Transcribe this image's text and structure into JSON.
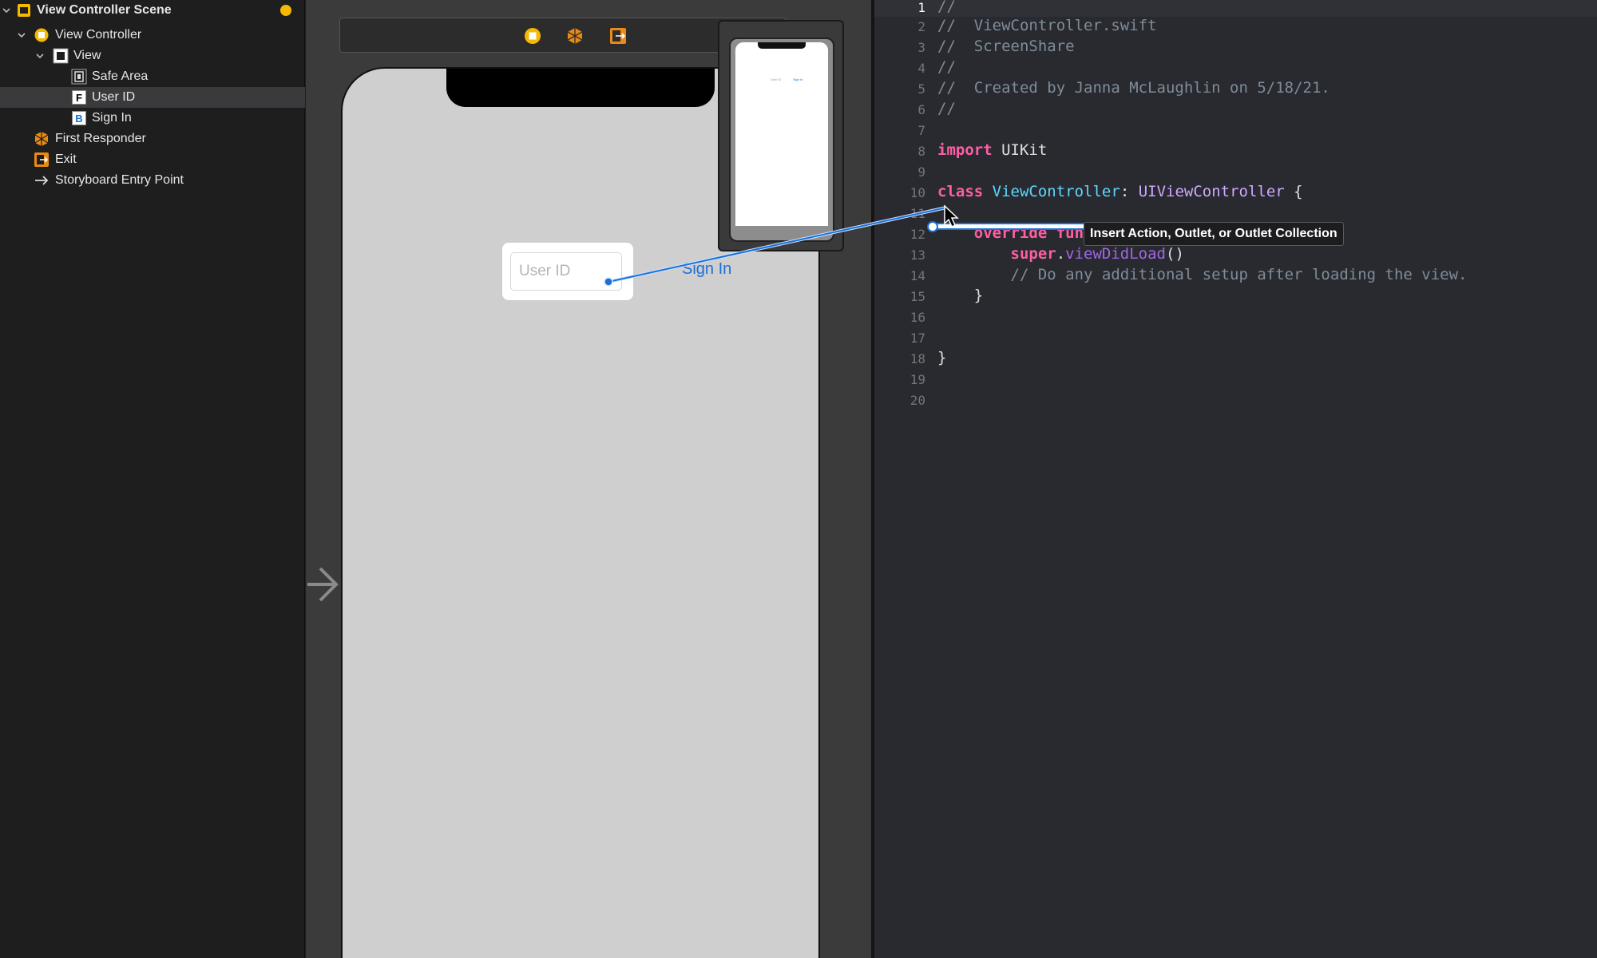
{
  "outline": {
    "items": [
      {
        "label": "View Controller Scene",
        "level": 0
      },
      {
        "label": "View Controller",
        "level": 1
      },
      {
        "label": "View",
        "level": 2
      },
      {
        "label": "Safe Area",
        "level": 3
      },
      {
        "label": "User ID",
        "level": 3,
        "icon_letter": "F"
      },
      {
        "label": "Sign In",
        "level": 3,
        "icon_letter": "B"
      },
      {
        "label": "First Responder",
        "level": 1
      },
      {
        "label": "Exit",
        "level": 1
      },
      {
        "label": "Storyboard Entry Point",
        "level": 1
      }
    ]
  },
  "canvas": {
    "userid_placeholder": "User ID",
    "signin_label": "Sign In"
  },
  "editor": {
    "line_numbers": [
      "1",
      "2",
      "3",
      "4",
      "5",
      "6",
      "7",
      "8",
      "9",
      "10",
      "11",
      "12",
      "13",
      "14",
      "15",
      "16",
      "17",
      "18",
      "19",
      "20"
    ],
    "code": {
      "l1": "//",
      "l2": "//  ViewController.swift",
      "l3": "//  ScreenShare",
      "l4": "//",
      "l5": "//  Created by Janna McLaughlin on 5/18/21.",
      "l6": "//",
      "l8_kw": "import",
      "l8_rest": " UIKit",
      "l10_kw": "class",
      "l10_name": "ViewController",
      "l10_colon": ": ",
      "l10_super": "UIViewController",
      "l10_brace": " {",
      "l12_indent": "    ",
      "l12_kw": "override fun",
      "l13_indent": "        ",
      "l13_kw": "super",
      "l13_dot": ".",
      "l13_fn": "viewDidLoad",
      "l13_parens": "()",
      "l14": "        // Do any additional setup after loading the view.",
      "l15": "    }",
      "l18": "}"
    },
    "tooltip": "Insert Action, Outlet, or Outlet Collection"
  },
  "colors": {
    "accent_blue": "#1a6fd8",
    "badge_yellow": "#f5b900",
    "keyword_pink": "#fc5fa3"
  }
}
